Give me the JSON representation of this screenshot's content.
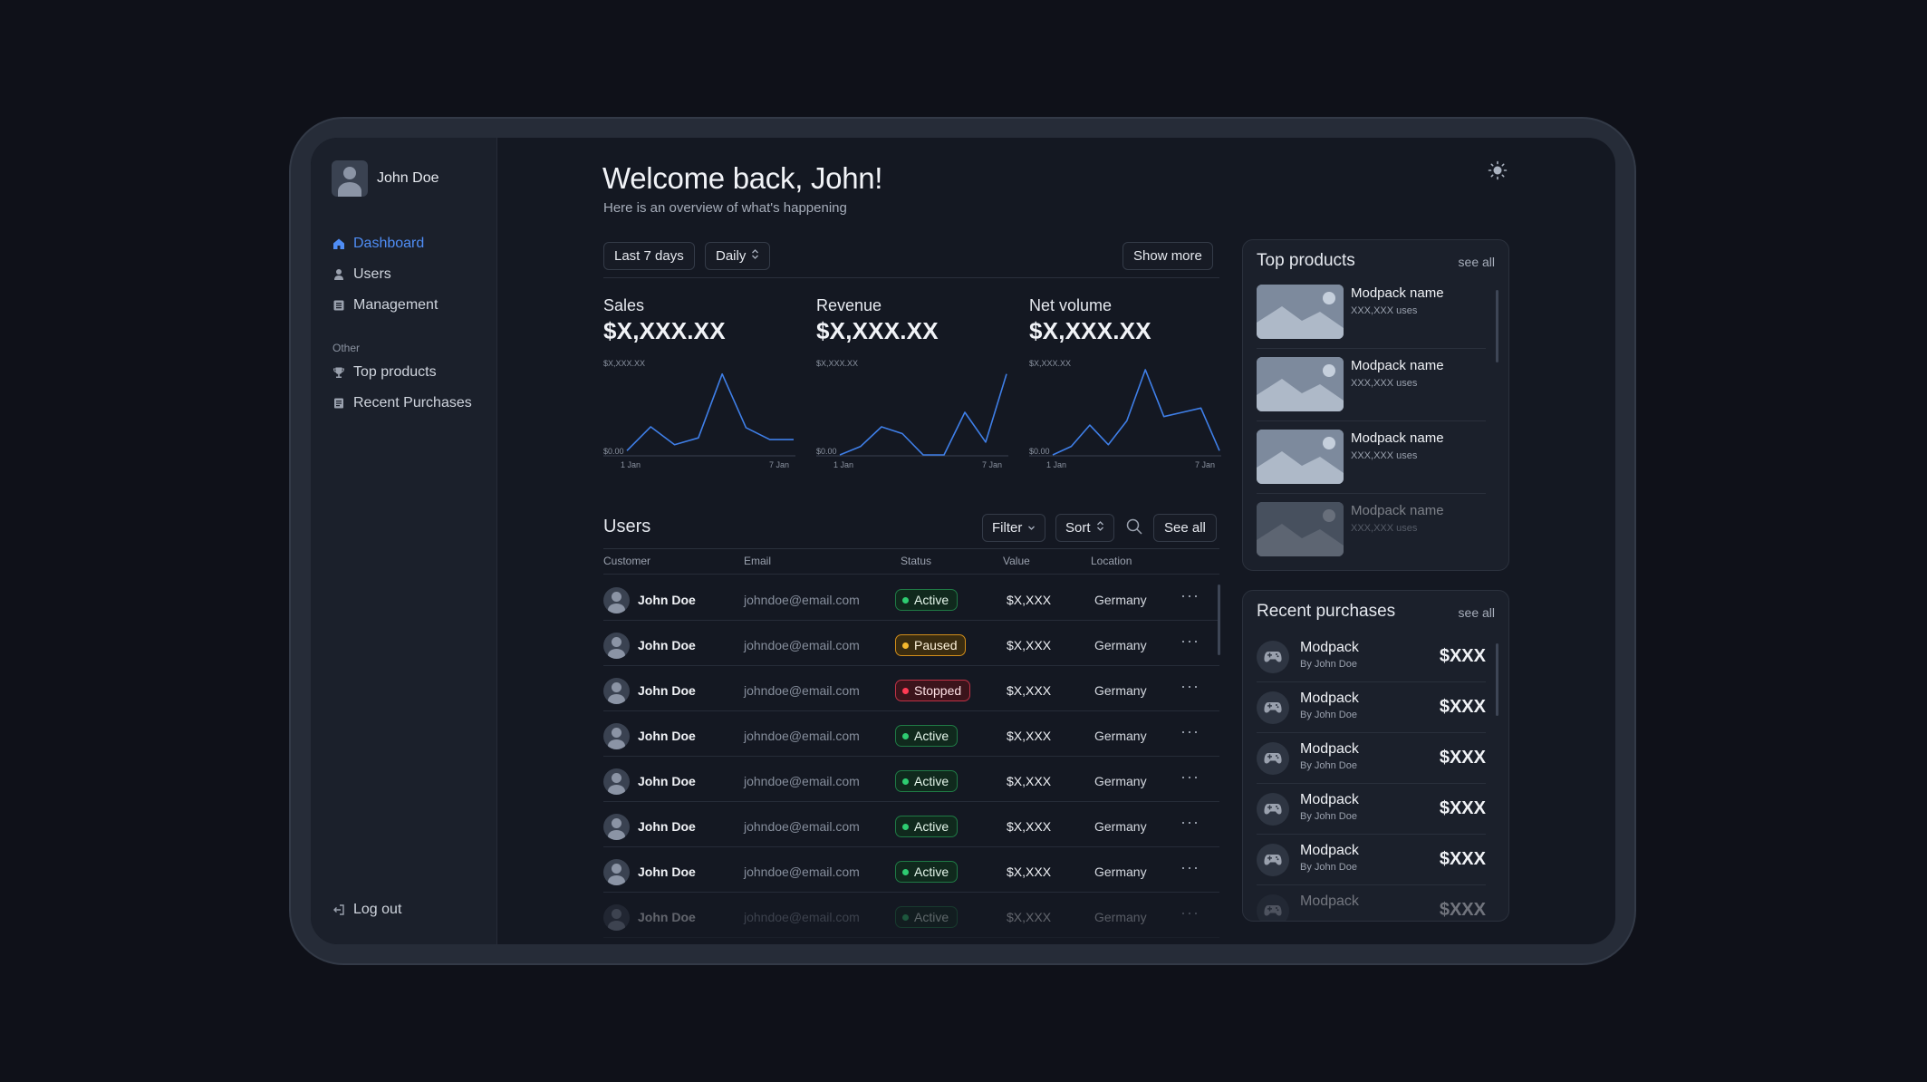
{
  "sidebar": {
    "profile_name": "John Doe",
    "nav": [
      {
        "label": "Dashboard",
        "icon": "home-icon"
      },
      {
        "label": "Users",
        "icon": "user-icon"
      },
      {
        "label": "Management",
        "icon": "list-icon"
      }
    ],
    "section_label": "Other",
    "nav_other": [
      {
        "label": "Top products",
        "icon": "trophy-icon"
      },
      {
        "label": "Recent Purchases",
        "icon": "receipt-icon"
      }
    ],
    "logout_label": "Log out"
  },
  "header": {
    "title": "Welcome back, John!",
    "subtitle": "Here is an overview of what's happening"
  },
  "filters": {
    "range": "Last 7 days",
    "interval": "Daily",
    "show_more": "Show more"
  },
  "metrics": [
    {
      "title": "Sales",
      "value": "$X,XXX.XX",
      "top_label": "$X,XXX.XX",
      "zero_label": "$0.00",
      "x_start": "1 Jan",
      "x_end": "7 Jan"
    },
    {
      "title": "Revenue",
      "value": "$X,XXX.XX",
      "top_label": "$X,XXX.XX",
      "zero_label": "$0.00",
      "x_start": "1 Jan",
      "x_end": "7 Jan"
    },
    {
      "title": "Net volume",
      "value": "$X,XXX.XX",
      "top_label": "$X,XXX.XX",
      "zero_label": "$0.00",
      "x_start": "1 Jan",
      "x_end": "7 Jan"
    }
  ],
  "chart_data": [
    {
      "type": "line",
      "title": "Sales",
      "x": [
        1,
        2,
        3,
        4,
        5,
        6,
        7,
        8
      ],
      "values": [
        0.05,
        0.33,
        0.12,
        0.2,
        0.95,
        0.32,
        0.18,
        0.18
      ],
      "ylim": [
        0,
        1
      ],
      "line_color": "#3f7fe8"
    },
    {
      "type": "line",
      "title": "Revenue",
      "x": [
        1,
        2,
        3,
        4,
        5,
        6,
        7,
        8,
        9
      ],
      "values": [
        0.0,
        0.1,
        0.33,
        0.25,
        0.0,
        0.0,
        0.5,
        0.15,
        0.95
      ],
      "ylim": [
        0,
        1
      ],
      "line_color": "#3f7fe8"
    },
    {
      "type": "line",
      "title": "Net volume",
      "x": [
        1,
        2,
        3,
        4,
        5,
        6,
        7,
        8,
        9,
        10
      ],
      "values": [
        0.0,
        0.1,
        0.35,
        0.12,
        0.4,
        1.0,
        0.45,
        0.5,
        0.55,
        0.05
      ],
      "ylim": [
        0,
        1
      ],
      "line_color": "#3f7fe8"
    }
  ],
  "users": {
    "title": "Users",
    "filter_label": "Filter",
    "sort_label": "Sort",
    "see_all_label": "See all",
    "columns": [
      "Customer",
      "Email",
      "Status",
      "Value",
      "Location"
    ],
    "rows": [
      {
        "name": "John Doe",
        "email": "johndoe@email.com",
        "status": "Active",
        "value": "$X,XXX",
        "location": "Germany"
      },
      {
        "name": "John Doe",
        "email": "johndoe@email.com",
        "status": "Paused",
        "value": "$X,XXX",
        "location": "Germany"
      },
      {
        "name": "John Doe",
        "email": "johndoe@email.com",
        "status": "Stopped",
        "value": "$X,XXX",
        "location": "Germany"
      },
      {
        "name": "John Doe",
        "email": "johndoe@email.com",
        "status": "Active",
        "value": "$X,XXX",
        "location": "Germany"
      },
      {
        "name": "John Doe",
        "email": "johndoe@email.com",
        "status": "Active",
        "value": "$X,XXX",
        "location": "Germany"
      },
      {
        "name": "John Doe",
        "email": "johndoe@email.com",
        "status": "Active",
        "value": "$X,XXX",
        "location": "Germany"
      },
      {
        "name": "John Doe",
        "email": "johndoe@email.com",
        "status": "Active",
        "value": "$X,XXX",
        "location": "Germany"
      },
      {
        "name": "John Doe",
        "email": "johndoe@email.com",
        "status": "Active",
        "value": "$X,XXX",
        "location": "Germany"
      }
    ],
    "more_label": "···"
  },
  "top_products": {
    "title": "Top products",
    "see_all": "see all",
    "items": [
      {
        "name": "Modpack name",
        "uses": "XXX,XXX uses"
      },
      {
        "name": "Modpack name",
        "uses": "XXX,XXX uses"
      },
      {
        "name": "Modpack name",
        "uses": "XXX,XXX uses"
      },
      {
        "name": "Modpack name",
        "uses": "XXX,XXX uses"
      }
    ]
  },
  "recent_purchases": {
    "title": "Recent purchases",
    "see_all": "see all",
    "items": [
      {
        "name": "Modpack",
        "by": "By John Doe",
        "price": "$XXX"
      },
      {
        "name": "Modpack",
        "by": "By John Doe",
        "price": "$XXX"
      },
      {
        "name": "Modpack",
        "by": "By John Doe",
        "price": "$XXX"
      },
      {
        "name": "Modpack",
        "by": "By John Doe",
        "price": "$XXX"
      },
      {
        "name": "Modpack",
        "by": "By John Doe",
        "price": "$XXX"
      },
      {
        "name": "Modpack",
        "by": "",
        "price": "$XXX"
      }
    ]
  },
  "colors": {
    "accent": "#4f8df5",
    "active": "#2ecc71",
    "paused": "#f5b82e",
    "stopped": "#ff3b54"
  }
}
